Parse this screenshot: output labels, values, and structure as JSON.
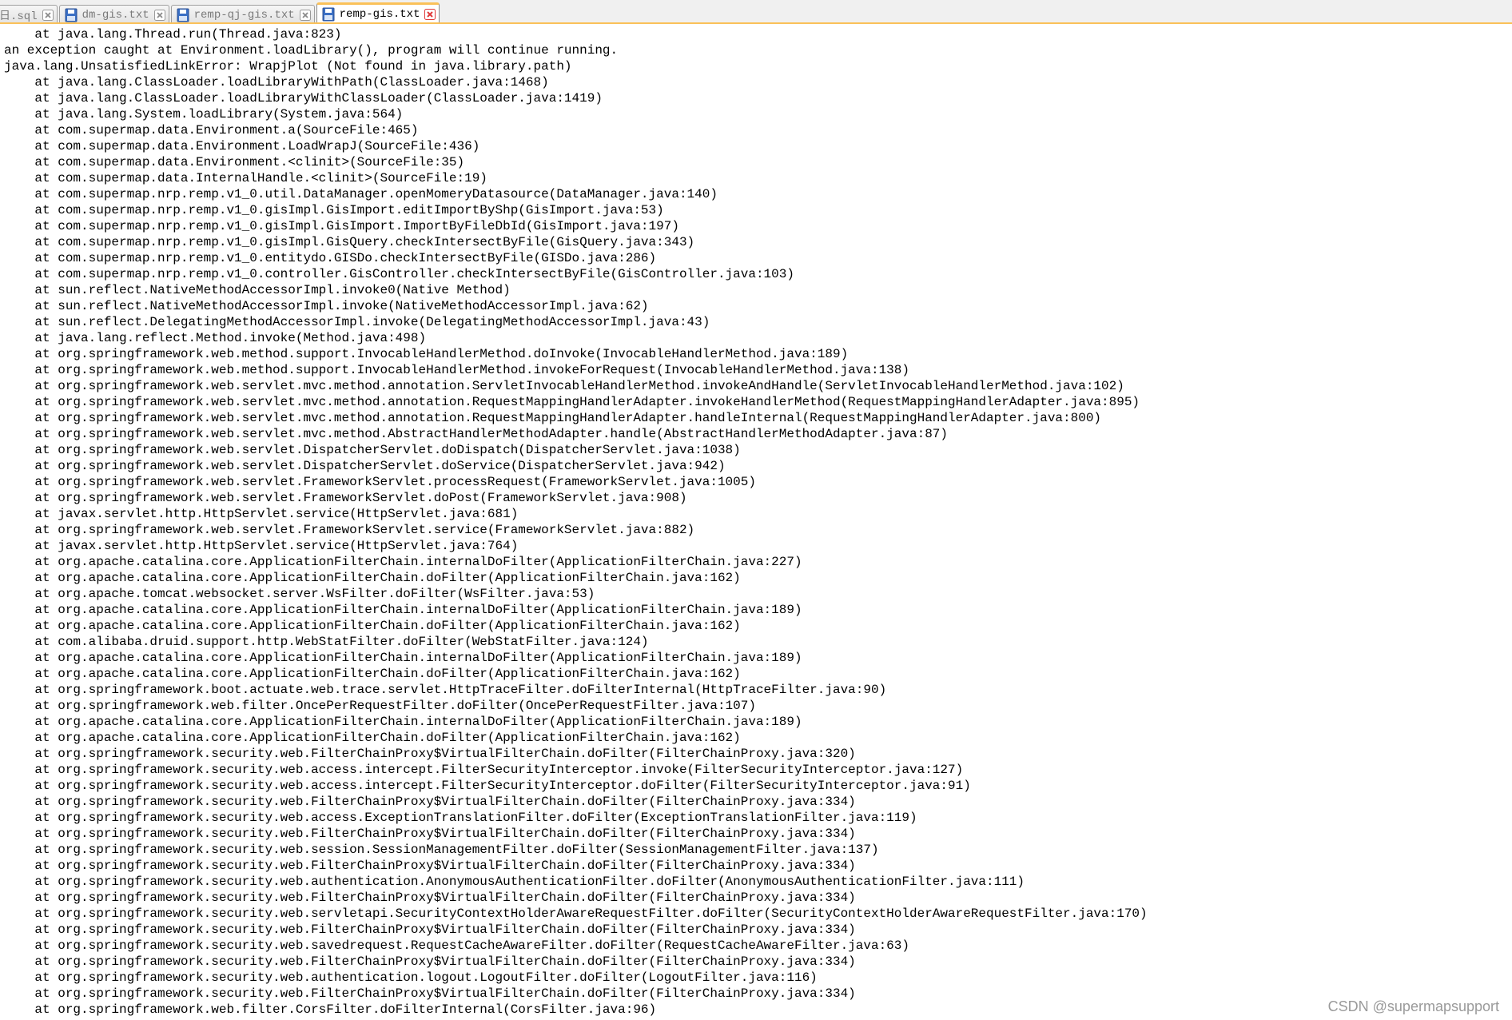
{
  "tabs": [
    {
      "label": "日.sql",
      "icon": "database-file-icon",
      "active": false
    },
    {
      "label": "dm-gis.txt",
      "icon": "save-file-icon",
      "active": false
    },
    {
      "label": "remp-qj-gis.txt",
      "icon": "save-file-icon",
      "active": false
    },
    {
      "label": "remp-gis.txt",
      "icon": "save-file-icon",
      "active": true
    }
  ],
  "colors": {
    "tab_accent": "#fac159",
    "file_icon_blue": "#3a6fc4",
    "close_inactive": "#9a9a9a",
    "close_active": "#e03a3a",
    "text": "#000000",
    "watermark": "#9a9a9a"
  },
  "editor": {
    "lines": [
      "    at java.lang.Thread.run(Thread.java:823)",
      "an exception caught at Environment.loadLibrary(), program will continue running.",
      "java.lang.UnsatisfiedLinkError: WrapjPlot (Not found in java.library.path)",
      "    at java.lang.ClassLoader.loadLibraryWithPath(ClassLoader.java:1468)",
      "    at java.lang.ClassLoader.loadLibraryWithClassLoader(ClassLoader.java:1419)",
      "    at java.lang.System.loadLibrary(System.java:564)",
      "    at com.supermap.data.Environment.a(SourceFile:465)",
      "    at com.supermap.data.Environment.LoadWrapJ(SourceFile:436)",
      "    at com.supermap.data.Environment.<clinit>(SourceFile:35)",
      "    at com.supermap.data.InternalHandle.<clinit>(SourceFile:19)",
      "    at com.supermap.nrp.remp.v1_0.util.DataManager.openMomeryDatasource(DataManager.java:140)",
      "    at com.supermap.nrp.remp.v1_0.gisImpl.GisImport.editImportByShp(GisImport.java:53)",
      "    at com.supermap.nrp.remp.v1_0.gisImpl.GisImport.ImportByFileDbId(GisImport.java:197)",
      "    at com.supermap.nrp.remp.v1_0.gisImpl.GisQuery.checkIntersectByFile(GisQuery.java:343)",
      "    at com.supermap.nrp.remp.v1_0.entitydo.GISDo.checkIntersectByFile(GISDo.java:286)",
      "    at com.supermap.nrp.remp.v1_0.controller.GisController.checkIntersectByFile(GisController.java:103)",
      "    at sun.reflect.NativeMethodAccessorImpl.invoke0(Native Method)",
      "    at sun.reflect.NativeMethodAccessorImpl.invoke(NativeMethodAccessorImpl.java:62)",
      "    at sun.reflect.DelegatingMethodAccessorImpl.invoke(DelegatingMethodAccessorImpl.java:43)",
      "    at java.lang.reflect.Method.invoke(Method.java:498)",
      "    at org.springframework.web.method.support.InvocableHandlerMethod.doInvoke(InvocableHandlerMethod.java:189)",
      "    at org.springframework.web.method.support.InvocableHandlerMethod.invokeForRequest(InvocableHandlerMethod.java:138)",
      "    at org.springframework.web.servlet.mvc.method.annotation.ServletInvocableHandlerMethod.invokeAndHandle(ServletInvocableHandlerMethod.java:102)",
      "    at org.springframework.web.servlet.mvc.method.annotation.RequestMappingHandlerAdapter.invokeHandlerMethod(RequestMappingHandlerAdapter.java:895)",
      "    at org.springframework.web.servlet.mvc.method.annotation.RequestMappingHandlerAdapter.handleInternal(RequestMappingHandlerAdapter.java:800)",
      "    at org.springframework.web.servlet.mvc.method.AbstractHandlerMethodAdapter.handle(AbstractHandlerMethodAdapter.java:87)",
      "    at org.springframework.web.servlet.DispatcherServlet.doDispatch(DispatcherServlet.java:1038)",
      "    at org.springframework.web.servlet.DispatcherServlet.doService(DispatcherServlet.java:942)",
      "    at org.springframework.web.servlet.FrameworkServlet.processRequest(FrameworkServlet.java:1005)",
      "    at org.springframework.web.servlet.FrameworkServlet.doPost(FrameworkServlet.java:908)",
      "    at javax.servlet.http.HttpServlet.service(HttpServlet.java:681)",
      "    at org.springframework.web.servlet.FrameworkServlet.service(FrameworkServlet.java:882)",
      "    at javax.servlet.http.HttpServlet.service(HttpServlet.java:764)",
      "    at org.apache.catalina.core.ApplicationFilterChain.internalDoFilter(ApplicationFilterChain.java:227)",
      "    at org.apache.catalina.core.ApplicationFilterChain.doFilter(ApplicationFilterChain.java:162)",
      "    at org.apache.tomcat.websocket.server.WsFilter.doFilter(WsFilter.java:53)",
      "    at org.apache.catalina.core.ApplicationFilterChain.internalDoFilter(ApplicationFilterChain.java:189)",
      "    at org.apache.catalina.core.ApplicationFilterChain.doFilter(ApplicationFilterChain.java:162)",
      "    at com.alibaba.druid.support.http.WebStatFilter.doFilter(WebStatFilter.java:124)",
      "    at org.apache.catalina.core.ApplicationFilterChain.internalDoFilter(ApplicationFilterChain.java:189)",
      "    at org.apache.catalina.core.ApplicationFilterChain.doFilter(ApplicationFilterChain.java:162)",
      "    at org.springframework.boot.actuate.web.trace.servlet.HttpTraceFilter.doFilterInternal(HttpTraceFilter.java:90)",
      "    at org.springframework.web.filter.OncePerRequestFilter.doFilter(OncePerRequestFilter.java:107)",
      "    at org.apache.catalina.core.ApplicationFilterChain.internalDoFilter(ApplicationFilterChain.java:189)",
      "    at org.apache.catalina.core.ApplicationFilterChain.doFilter(ApplicationFilterChain.java:162)",
      "    at org.springframework.security.web.FilterChainProxy$VirtualFilterChain.doFilter(FilterChainProxy.java:320)",
      "    at org.springframework.security.web.access.intercept.FilterSecurityInterceptor.invoke(FilterSecurityInterceptor.java:127)",
      "    at org.springframework.security.web.access.intercept.FilterSecurityInterceptor.doFilter(FilterSecurityInterceptor.java:91)",
      "    at org.springframework.security.web.FilterChainProxy$VirtualFilterChain.doFilter(FilterChainProxy.java:334)",
      "    at org.springframework.security.web.access.ExceptionTranslationFilter.doFilter(ExceptionTranslationFilter.java:119)",
      "    at org.springframework.security.web.FilterChainProxy$VirtualFilterChain.doFilter(FilterChainProxy.java:334)",
      "    at org.springframework.security.web.session.SessionManagementFilter.doFilter(SessionManagementFilter.java:137)",
      "    at org.springframework.security.web.FilterChainProxy$VirtualFilterChain.doFilter(FilterChainProxy.java:334)",
      "    at org.springframework.security.web.authentication.AnonymousAuthenticationFilter.doFilter(AnonymousAuthenticationFilter.java:111)",
      "    at org.springframework.security.web.FilterChainProxy$VirtualFilterChain.doFilter(FilterChainProxy.java:334)",
      "    at org.springframework.security.web.servletapi.SecurityContextHolderAwareRequestFilter.doFilter(SecurityContextHolderAwareRequestFilter.java:170)",
      "    at org.springframework.security.web.FilterChainProxy$VirtualFilterChain.doFilter(FilterChainProxy.java:334)",
      "    at org.springframework.security.web.savedrequest.RequestCacheAwareFilter.doFilter(RequestCacheAwareFilter.java:63)",
      "    at org.springframework.security.web.FilterChainProxy$VirtualFilterChain.doFilter(FilterChainProxy.java:334)",
      "    at org.springframework.security.web.authentication.logout.LogoutFilter.doFilter(LogoutFilter.java:116)",
      "    at org.springframework.security.web.FilterChainProxy$VirtualFilterChain.doFilter(FilterChainProxy.java:334)",
      "    at org.springframework.web.filter.CorsFilter.doFilterInternal(CorsFilter.java:96)"
    ]
  },
  "watermark": "CSDN @supermapsupport"
}
